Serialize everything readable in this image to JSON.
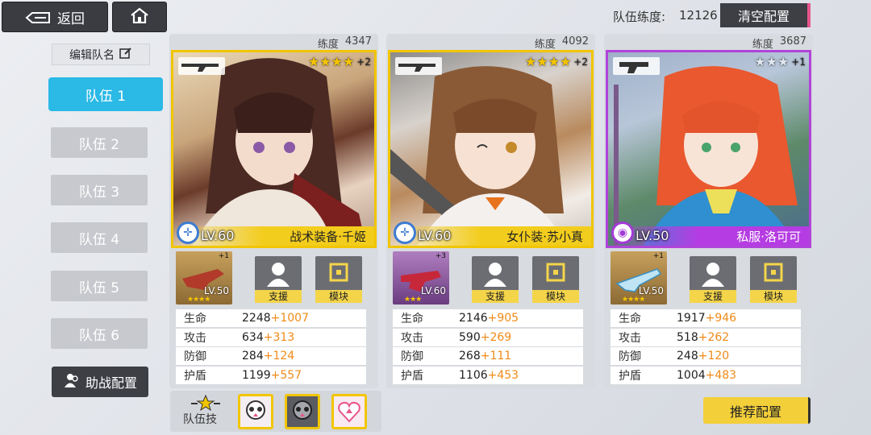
{
  "nav": {
    "back_label": "返回"
  },
  "team_level": {
    "label": "队伍练度:",
    "value": "12126"
  },
  "clear_label": "清空配置",
  "sidebar": {
    "rename_label": "编辑队名",
    "teams": [
      "队伍 1",
      "队伍 2",
      "队伍 3",
      "队伍 4",
      "队伍 5",
      "队伍 6"
    ],
    "support_label": "助战配置"
  },
  "cards": [
    {
      "lv_label": "练度",
      "lv_value": "4347",
      "stars": "★★★★",
      "plus": "+2",
      "level": "LV.60",
      "name": "战术装备·千姬",
      "weapon_level": "LV.50",
      "weapon_stars": "★★★★",
      "weapon_plus": "+1",
      "support_label": "支援",
      "module_label": "模块",
      "stats": [
        {
          "k": "生命",
          "v": "2248",
          "b": "+1007"
        },
        {
          "k": "攻击",
          "v": "634",
          "b": "+313"
        },
        {
          "k": "防御",
          "v": "284",
          "b": "+124"
        },
        {
          "k": "护盾",
          "v": "1199",
          "b": "+557"
        }
      ]
    },
    {
      "lv_label": "练度",
      "lv_value": "4092",
      "stars": "★★★★",
      "plus": "+2",
      "level": "LV.60",
      "name": "女仆装·苏小真",
      "weapon_level": "LV.60",
      "weapon_stars": "★★★",
      "weapon_plus": "+3",
      "support_label": "支援",
      "module_label": "模块",
      "stats": [
        {
          "k": "生命",
          "v": "2146",
          "b": "+905"
        },
        {
          "k": "攻击",
          "v": "590",
          "b": "+269"
        },
        {
          "k": "防御",
          "v": "268",
          "b": "+111"
        },
        {
          "k": "护盾",
          "v": "1106",
          "b": "+453"
        }
      ]
    },
    {
      "lv_label": "练度",
      "lv_value": "3687",
      "stars": "★★★",
      "plus": "+1",
      "level": "LV.50",
      "name": "私服·洛可可",
      "weapon_level": "LV.50",
      "weapon_stars": "★★★★",
      "weapon_plus": "+1",
      "support_label": "支援",
      "module_label": "模块",
      "stats": [
        {
          "k": "生命",
          "v": "1917",
          "b": "+946"
        },
        {
          "k": "攻击",
          "v": "518",
          "b": "+262"
        },
        {
          "k": "防御",
          "v": "248",
          "b": "+120"
        },
        {
          "k": "护盾",
          "v": "1004",
          "b": "+483"
        }
      ]
    }
  ],
  "team_skill_label": "队伍技",
  "recommend_label": "推荐配置",
  "colors": {
    "accent": "#2bb9e6",
    "gold": "#f1c500",
    "purple": "#b044d8",
    "bonus": "#f08a17"
  }
}
